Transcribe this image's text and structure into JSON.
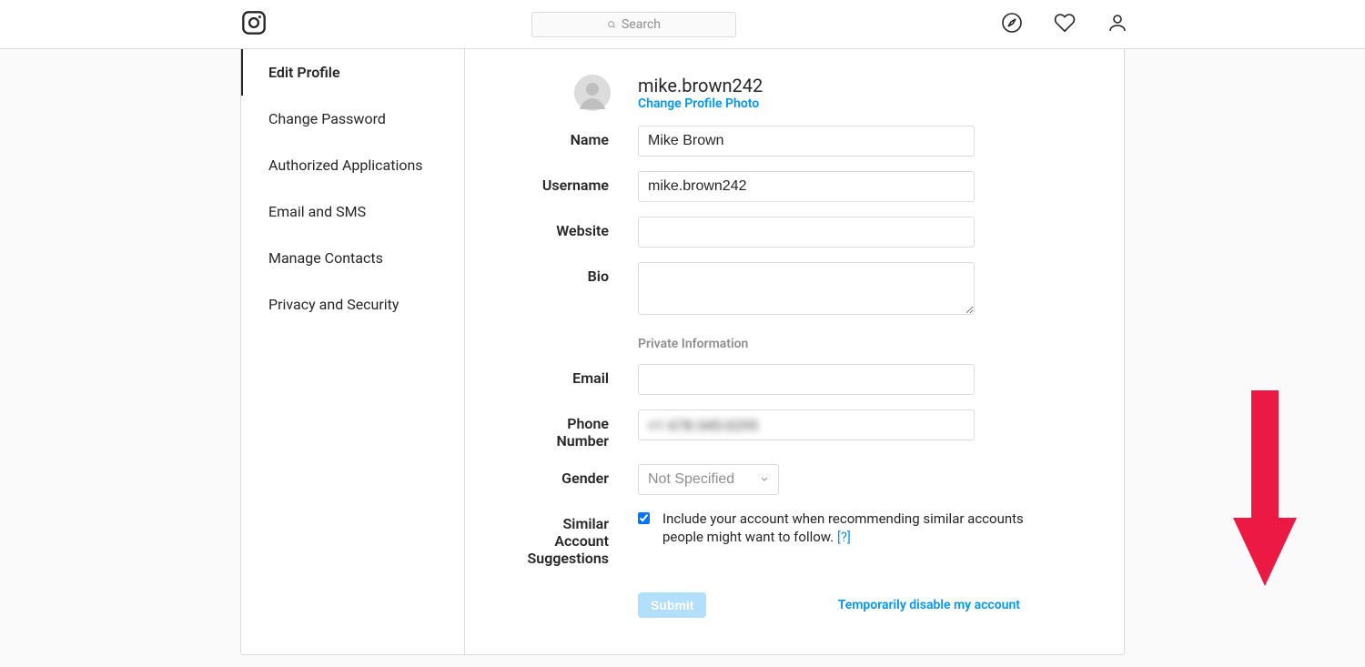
{
  "nav": {
    "search_placeholder": "Search"
  },
  "sidebar": {
    "items": [
      {
        "label": "Edit Profile"
      },
      {
        "label": "Change Password"
      },
      {
        "label": "Authorized Applications"
      },
      {
        "label": "Email and SMS"
      },
      {
        "label": "Manage Contacts"
      },
      {
        "label": "Privacy and Security"
      }
    ]
  },
  "profile": {
    "username_display": "mike.brown242",
    "change_photo_label": "Change Profile Photo"
  },
  "form": {
    "name_label": "Name",
    "name_value": "Mike Brown",
    "username_label": "Username",
    "username_value": "mike.brown242",
    "website_label": "Website",
    "website_value": "",
    "bio_label": "Bio",
    "bio_value": "",
    "private_info_heading": "Private Information",
    "email_label": "Email",
    "email_value": "",
    "phone_label": "Phone Number",
    "phone_value": "+1 678-345-0295",
    "gender_label": "Gender",
    "gender_value": "Not Specified",
    "similar_label_line1": "Similar Account",
    "similar_label_line2": "Suggestions",
    "similar_checked": true,
    "similar_text": "Include your account when recommending similar accounts people might want to follow.",
    "help_link": "[?]",
    "submit_label": "Submit",
    "disable_label": "Temporarily disable my account"
  }
}
